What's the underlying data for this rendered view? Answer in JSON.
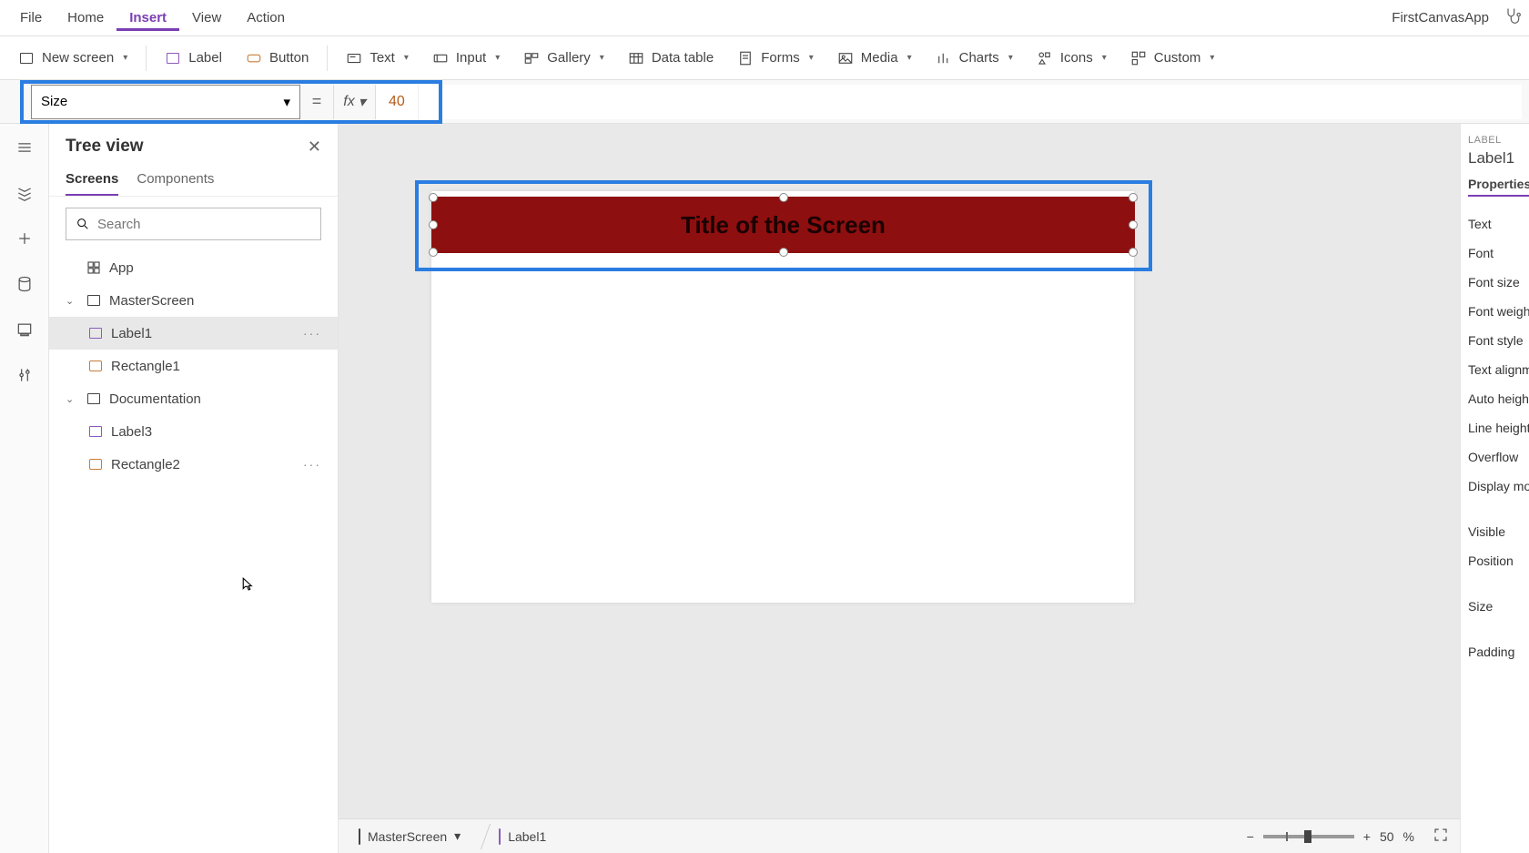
{
  "menubar": {
    "items": [
      "File",
      "Home",
      "Insert",
      "View",
      "Action"
    ],
    "active_index": 2,
    "app_name": "FirstCanvasApp"
  },
  "toolbar": {
    "new_screen": "New screen",
    "label": "Label",
    "button": "Button",
    "text": "Text",
    "input": "Input",
    "gallery": "Gallery",
    "data_table": "Data table",
    "forms": "Forms",
    "media": "Media",
    "charts": "Charts",
    "icons": "Icons",
    "custom": "Custom"
  },
  "formula": {
    "property": "Size",
    "equals": "=",
    "fx": "fx",
    "value": "40"
  },
  "tree": {
    "title": "Tree view",
    "tabs": [
      "Screens",
      "Components"
    ],
    "active_tab": 0,
    "search_placeholder": "Search",
    "nodes": {
      "app": "App",
      "master": "MasterScreen",
      "label1": "Label1",
      "rect1": "Rectangle1",
      "doc": "Documentation",
      "label3": "Label3",
      "rect2": "Rectangle2"
    }
  },
  "canvas": {
    "label_text": "Title of the Screen"
  },
  "status": {
    "screen": "MasterScreen",
    "element": "Label1",
    "zoom_value": "50",
    "zoom_unit": "%"
  },
  "properties": {
    "caption": "LABEL",
    "name": "Label1",
    "tab": "Properties",
    "rows": [
      "Text",
      "Font",
      "Font size",
      "Font weight",
      "Font style",
      "Text alignment",
      "Auto height",
      "Line height",
      "Overflow",
      "Display mode",
      "Visible",
      "Position",
      "Size",
      "Padding"
    ]
  }
}
